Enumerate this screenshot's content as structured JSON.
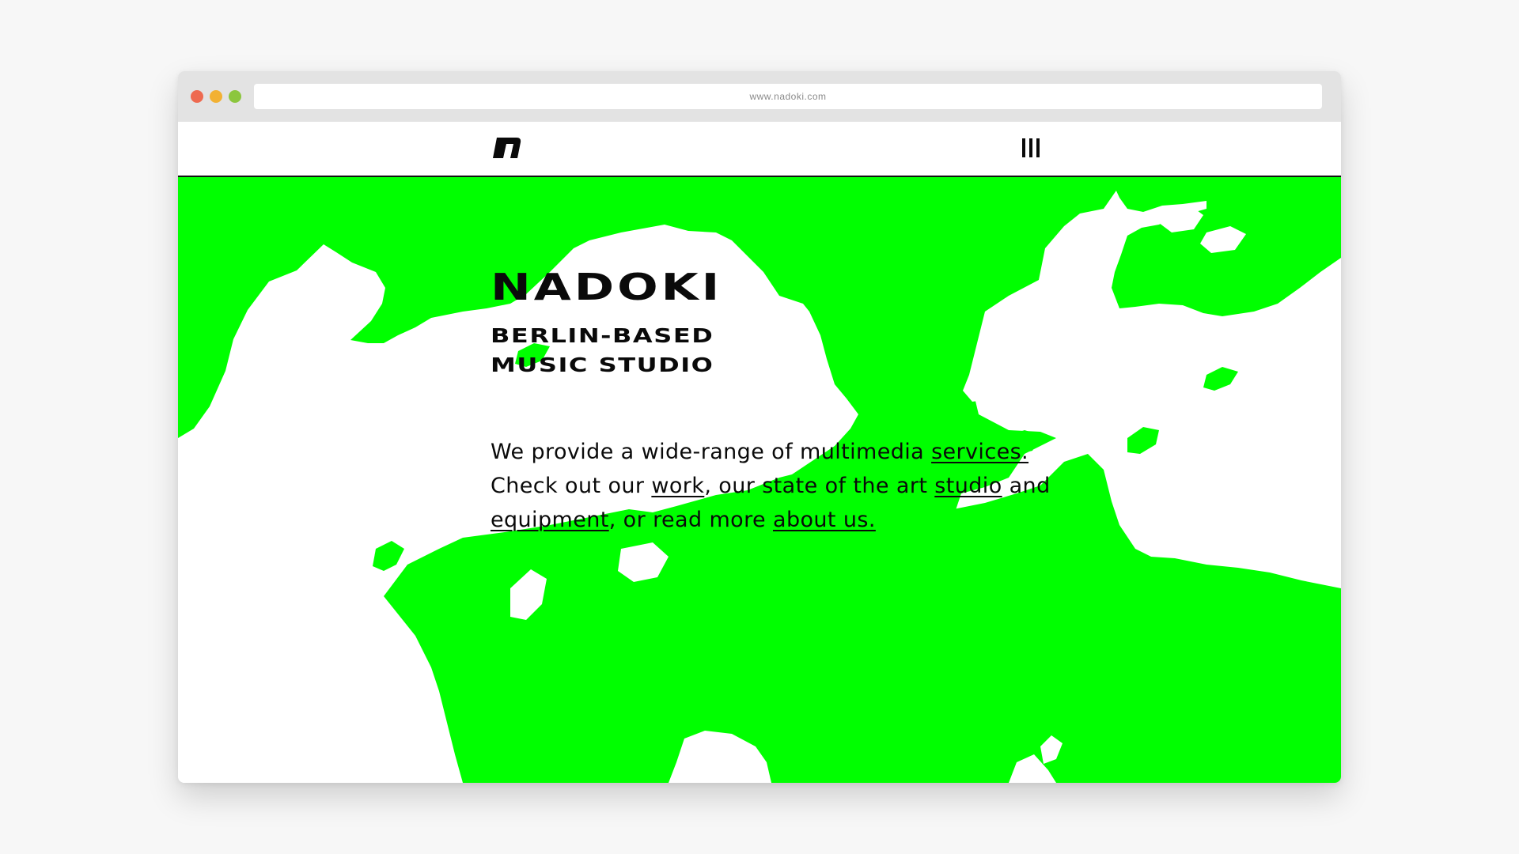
{
  "browser": {
    "url": "www.nadoki.com",
    "traffic_lights": {
      "close_color": "#ee6a50",
      "minimize_color": "#f2b133",
      "zoom_color": "#8cc63e"
    }
  },
  "header": {
    "logo_icon": "nadoki-n-logo",
    "menu_icon": "menu-bars-icon"
  },
  "hero": {
    "title": "NADOKI",
    "subtitle_line1": "BERLIN-BASED",
    "subtitle_line2": "MUSIC STUDIO",
    "intro": {
      "t1": "We provide a wide-range of multimedia ",
      "link_services": "services.",
      "t2": " Check out our ",
      "link_work": "work",
      "t3": ", our state of the art ",
      "link_studio": "studio",
      "t4": " and ",
      "link_equipment": "equipment",
      "t5": ", or read more ",
      "link_about": "about us."
    }
  },
  "colors": {
    "accent_green": "#00ff00",
    "text": "#0a0a0a",
    "page_bg": "#f7f7f7",
    "chrome_bg": "#e3e3e3"
  }
}
